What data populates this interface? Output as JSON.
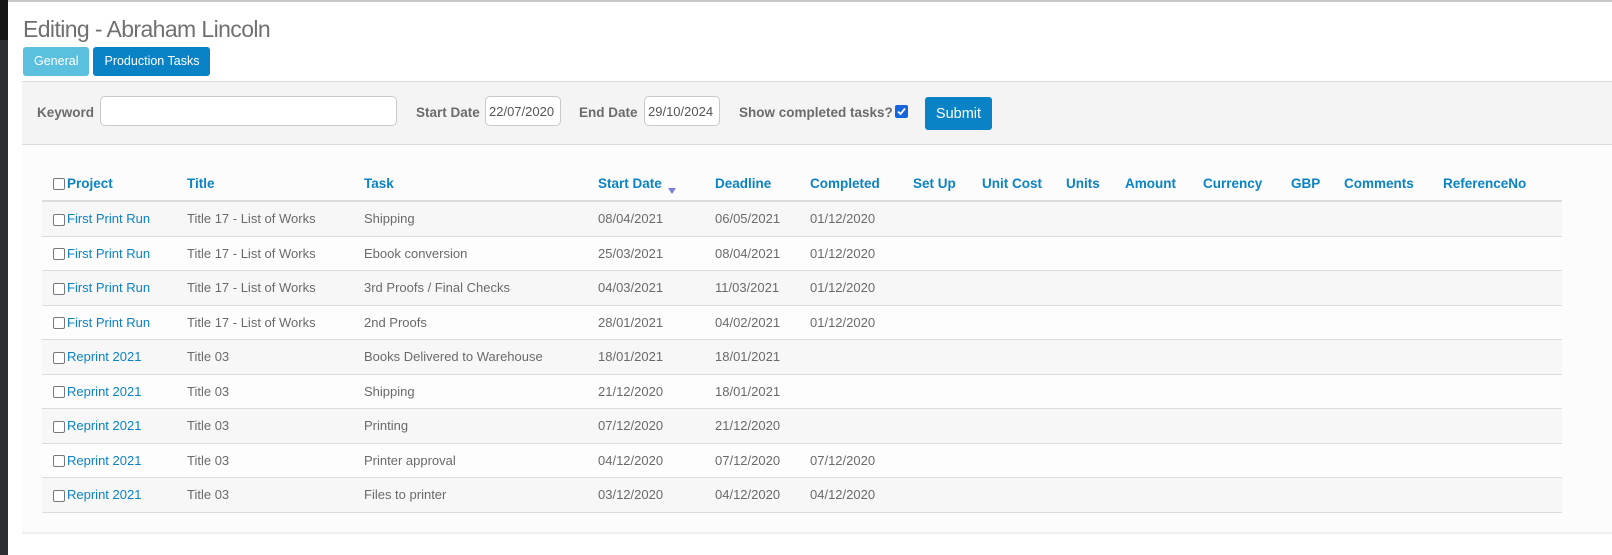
{
  "page": {
    "title": "Editing - Abraham Lincoln",
    "tabs": [
      {
        "label": "General",
        "active": false
      },
      {
        "label": "Production Tasks",
        "active": true
      }
    ]
  },
  "filters": {
    "keyword_label": "Keyword",
    "keyword_value": "",
    "start_date_label": "Start Date",
    "start_date_value": "22/07/2020",
    "end_date_label": "End Date",
    "end_date_value": "29/10/2024",
    "show_completed_label": "Show completed tasks?",
    "show_completed_checked": true,
    "submit_label": "Submit"
  },
  "table": {
    "sorted_column": "Start Date",
    "sort_direction": "descending",
    "columns": [
      "Project",
      "Title",
      "Task",
      "Start Date",
      "Deadline",
      "Completed",
      "Set Up",
      "Unit Cost",
      "Units",
      "Amount",
      "Currency",
      "GBP",
      "Comments",
      "ReferenceNo"
    ],
    "rows": [
      {
        "project": "First Print Run",
        "title": "Title 17 - List of Works",
        "task": "Shipping",
        "start_date": "08/04/2021",
        "deadline": "06/05/2021",
        "completed": "01/12/2020",
        "set_up": "",
        "unit_cost": "",
        "units": "",
        "amount": "",
        "currency": "",
        "gbp": "",
        "comments": "",
        "reference_no": ""
      },
      {
        "project": "First Print Run",
        "title": "Title 17 - List of Works",
        "task": "Ebook conversion",
        "start_date": "25/03/2021",
        "deadline": "08/04/2021",
        "completed": "01/12/2020",
        "set_up": "",
        "unit_cost": "",
        "units": "",
        "amount": "",
        "currency": "",
        "gbp": "",
        "comments": "",
        "reference_no": ""
      },
      {
        "project": "First Print Run",
        "title": "Title 17 - List of Works",
        "task": "3rd Proofs / Final Checks",
        "start_date": "04/03/2021",
        "deadline": "11/03/2021",
        "completed": "01/12/2020",
        "set_up": "",
        "unit_cost": "",
        "units": "",
        "amount": "",
        "currency": "",
        "gbp": "",
        "comments": "",
        "reference_no": ""
      },
      {
        "project": "First Print Run",
        "title": "Title 17 - List of Works",
        "task": "2nd Proofs",
        "start_date": "28/01/2021",
        "deadline": "04/02/2021",
        "completed": "01/12/2020",
        "set_up": "",
        "unit_cost": "",
        "units": "",
        "amount": "",
        "currency": "",
        "gbp": "",
        "comments": "",
        "reference_no": ""
      },
      {
        "project": "Reprint 2021",
        "title": "Title 03",
        "task": "Books Delivered to Warehouse",
        "start_date": "18/01/2021",
        "deadline": "18/01/2021",
        "completed": "",
        "set_up": "",
        "unit_cost": "",
        "units": "",
        "amount": "",
        "currency": "",
        "gbp": "",
        "comments": "",
        "reference_no": ""
      },
      {
        "project": "Reprint 2021",
        "title": "Title 03",
        "task": "Shipping",
        "start_date": "21/12/2020",
        "deadline": "18/01/2021",
        "completed": "",
        "set_up": "",
        "unit_cost": "",
        "units": "",
        "amount": "",
        "currency": "",
        "gbp": "",
        "comments": "",
        "reference_no": ""
      },
      {
        "project": "Reprint 2021",
        "title": "Title 03",
        "task": "Printing",
        "start_date": "07/12/2020",
        "deadline": "21/12/2020",
        "completed": "",
        "set_up": "",
        "unit_cost": "",
        "units": "",
        "amount": "",
        "currency": "",
        "gbp": "",
        "comments": "",
        "reference_no": ""
      },
      {
        "project": "Reprint 2021",
        "title": "Title 03",
        "task": "Printer approval",
        "start_date": "04/12/2020",
        "deadline": "07/12/2020",
        "completed": "07/12/2020",
        "set_up": "",
        "unit_cost": "",
        "units": "",
        "amount": "",
        "currency": "",
        "gbp": "",
        "comments": "",
        "reference_no": ""
      },
      {
        "project": "Reprint 2021",
        "title": "Title 03",
        "task": "Files to printer",
        "start_date": "03/12/2020",
        "deadline": "04/12/2020",
        "completed": "04/12/2020",
        "set_up": "",
        "unit_cost": "",
        "units": "",
        "amount": "",
        "currency": "",
        "gbp": "",
        "comments": "",
        "reference_no": ""
      }
    ]
  },
  "colors": {
    "accent": "#0a83c6",
    "tab_general": "#5bc0de",
    "checkbox_checked": "#1565e0",
    "text_muted": "#6a6a6a"
  }
}
